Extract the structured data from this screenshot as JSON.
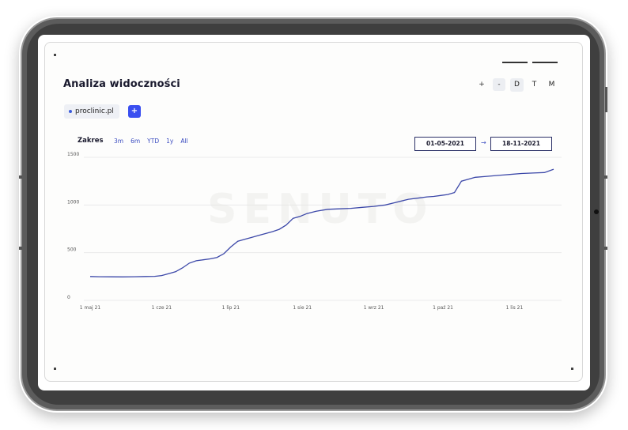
{
  "app": {
    "title": "Analiza widoczności",
    "watermark": "SENUTO",
    "accent_color": "#3a4ff0",
    "line_color": "#3b47a8"
  },
  "zoom": {
    "plus_label": "+",
    "minus_label": "-"
  },
  "periods": {
    "items": [
      "D",
      "T",
      "M"
    ],
    "active": "D"
  },
  "domain": {
    "name": "proclinic.pl",
    "add_label": "+"
  },
  "range": {
    "label": "Zakres",
    "options": [
      "3m",
      "6m",
      "YTD",
      "1y",
      "All"
    ],
    "date_from": "01-05-2021",
    "date_to": "18-11-2021",
    "arrow": "→"
  },
  "chart_data": {
    "type": "line",
    "ylim": [
      0,
      1500
    ],
    "yticks": [
      0,
      500,
      1000,
      1500
    ],
    "xticks": [
      "1 maj 21",
      "1 cze 21",
      "1 lip 21",
      "1 sie 21",
      "1 wrz 21",
      "1 paź 21",
      "1 lis 21"
    ],
    "grid": true,
    "legend": "none",
    "series": [
      {
        "x": [
          "2021-05-01",
          "2021-05-05",
          "2021-05-10",
          "2021-05-15",
          "2021-05-20",
          "2021-05-25",
          "2021-05-29",
          "2021-06-01",
          "2021-06-04",
          "2021-06-07",
          "2021-06-10",
          "2021-06-13",
          "2021-06-16",
          "2021-06-19",
          "2021-06-22",
          "2021-06-25",
          "2021-06-28",
          "2021-07-01",
          "2021-07-04",
          "2021-07-07",
          "2021-07-10",
          "2021-07-13",
          "2021-07-16",
          "2021-07-19",
          "2021-07-22",
          "2021-07-25",
          "2021-07-28",
          "2021-07-31",
          "2021-08-03",
          "2021-08-07",
          "2021-08-12",
          "2021-08-17",
          "2021-08-22",
          "2021-08-27",
          "2021-09-01",
          "2021-09-06",
          "2021-09-11",
          "2021-09-16",
          "2021-09-21",
          "2021-09-24",
          "2021-09-27",
          "2021-09-30",
          "2021-10-03",
          "2021-10-06",
          "2021-10-09",
          "2021-10-12",
          "2021-10-15",
          "2021-10-20",
          "2021-10-25",
          "2021-10-30",
          "2021-11-04",
          "2021-11-09",
          "2021-11-14",
          "2021-11-18"
        ],
        "values": [
          250,
          248,
          247,
          246,
          248,
          250,
          252,
          260,
          280,
          300,
          340,
          390,
          415,
          425,
          435,
          450,
          490,
          560,
          620,
          640,
          660,
          680,
          700,
          720,
          745,
          790,
          860,
          880,
          910,
          935,
          955,
          960,
          965,
          975,
          985,
          1000,
          1030,
          1060,
          1075,
          1085,
          1090,
          1100,
          1110,
          1130,
          1250,
          1270,
          1290,
          1300,
          1310,
          1320,
          1330,
          1335,
          1340,
          1375
        ]
      }
    ]
  }
}
